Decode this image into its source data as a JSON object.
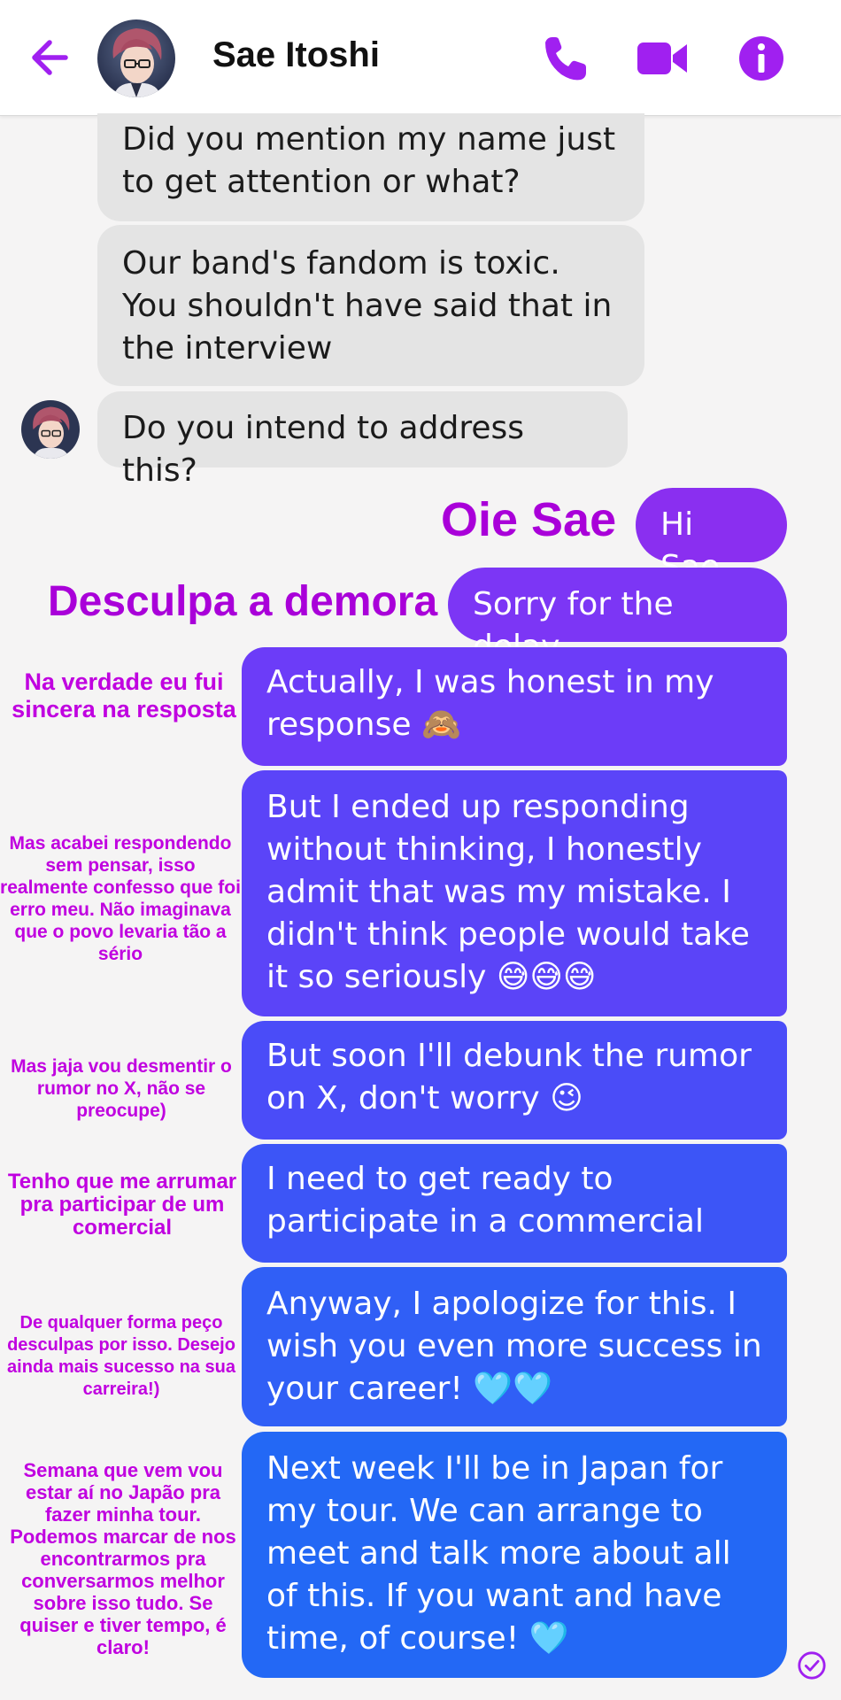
{
  "header": {
    "contact_name": "Sae Itoshi",
    "icons": [
      "back-arrow-icon",
      "phone-icon",
      "video-camera-icon",
      "info-icon"
    ],
    "accent_color": "#a020f0"
  },
  "incoming": [
    {
      "text": "Did you mention my name just to get attention or what?"
    },
    {
      "text": "Our band's fandom is toxic. You shouldn't have said that in the interview"
    },
    {
      "text": "Do you intend to address this?"
    }
  ],
  "outgoing": [
    {
      "text": "Hi Sae",
      "note": "Oie Sae"
    },
    {
      "text": "Sorry for the delay",
      "note": "Desculpa a demora"
    },
    {
      "text": "Actually, I was honest in my response",
      "emoji": "🙈",
      "note": "Na verdade eu fui sincera na resposta"
    },
    {
      "text": "But I ended up responding without thinking, I honestly admit that was my mistake. I didn't think people would take it so seriously",
      "emoji": "😅😅😅",
      "note": "Mas acabei respondendo sem pensar, isso realmente confesso que foi erro meu. Não imaginava que o povo levaria tão a sério"
    },
    {
      "text": "But soon I'll debunk the rumor on X, don't worry",
      "emoji": "😉",
      "note": "Mas jaja vou desmentir o rumor no X, não se preocupe)"
    },
    {
      "text": "I need to get ready to participate in a commercial",
      "note": "Tenho que me arrumar pra participar de um comercial"
    },
    {
      "text": "Anyway, I apologize for this. I wish you even more success in your career!",
      "emoji": "🩵🩵",
      "note": "De qualquer forma peço desculpas por isso. Desejo ainda mais sucesso na sua carreira!)"
    },
    {
      "text": "Next week I'll be in Japan for my tour. We can arrange to meet and talk more about all of this. If you want and have time, of course!",
      "emoji": "🩵",
      "note": "Semana que vem vou estar aí no Japão pra fazer minha tour. Podemos marcar de nos encontrarmos pra conversarmos melhor sobre isso tudo. Se quiser e tiver tempo, é claro!"
    }
  ],
  "status": {
    "icon": "seen-check-icon"
  }
}
